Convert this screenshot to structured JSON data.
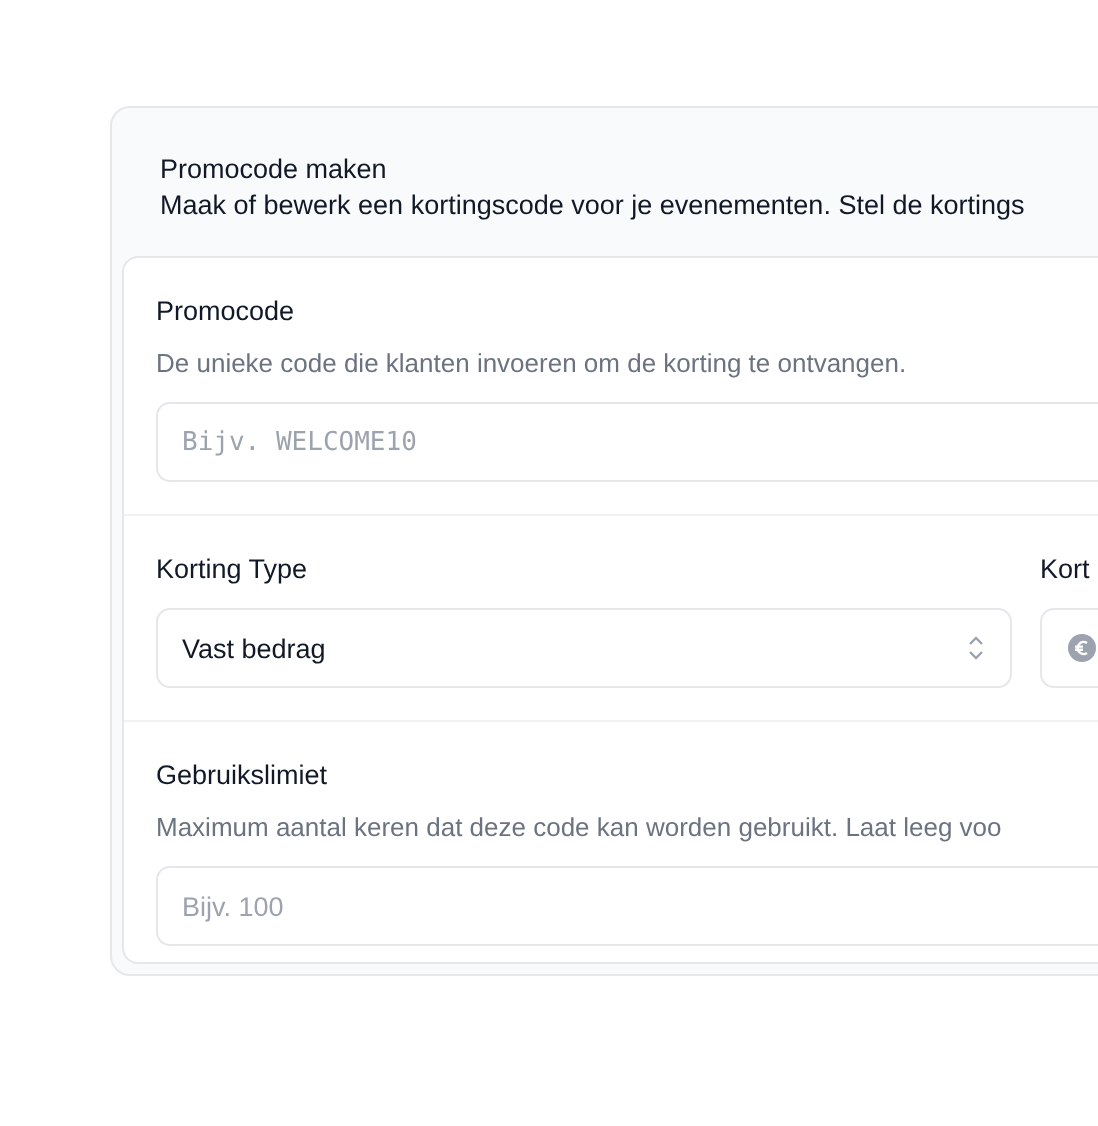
{
  "dialog": {
    "title": "Promocode maken",
    "description": "Maak of bewerk een kortingscode voor je evenementen. Stel de kortings"
  },
  "promo_code": {
    "label": "Promocode",
    "help": "De unieke code die klanten invoeren om de korting te ontvangen.",
    "placeholder": "Bijv. WELCOME10"
  },
  "discount_type": {
    "label": "Korting Type",
    "value": "Vast bedrag"
  },
  "discount_amount": {
    "label": "Kort"
  },
  "usage_limit": {
    "label": "Gebruikslimiet",
    "help": "Maximum aantal keren dat deze code kan worden gebruikt. Laat leeg voo",
    "placeholder": "Bijv. 100"
  }
}
